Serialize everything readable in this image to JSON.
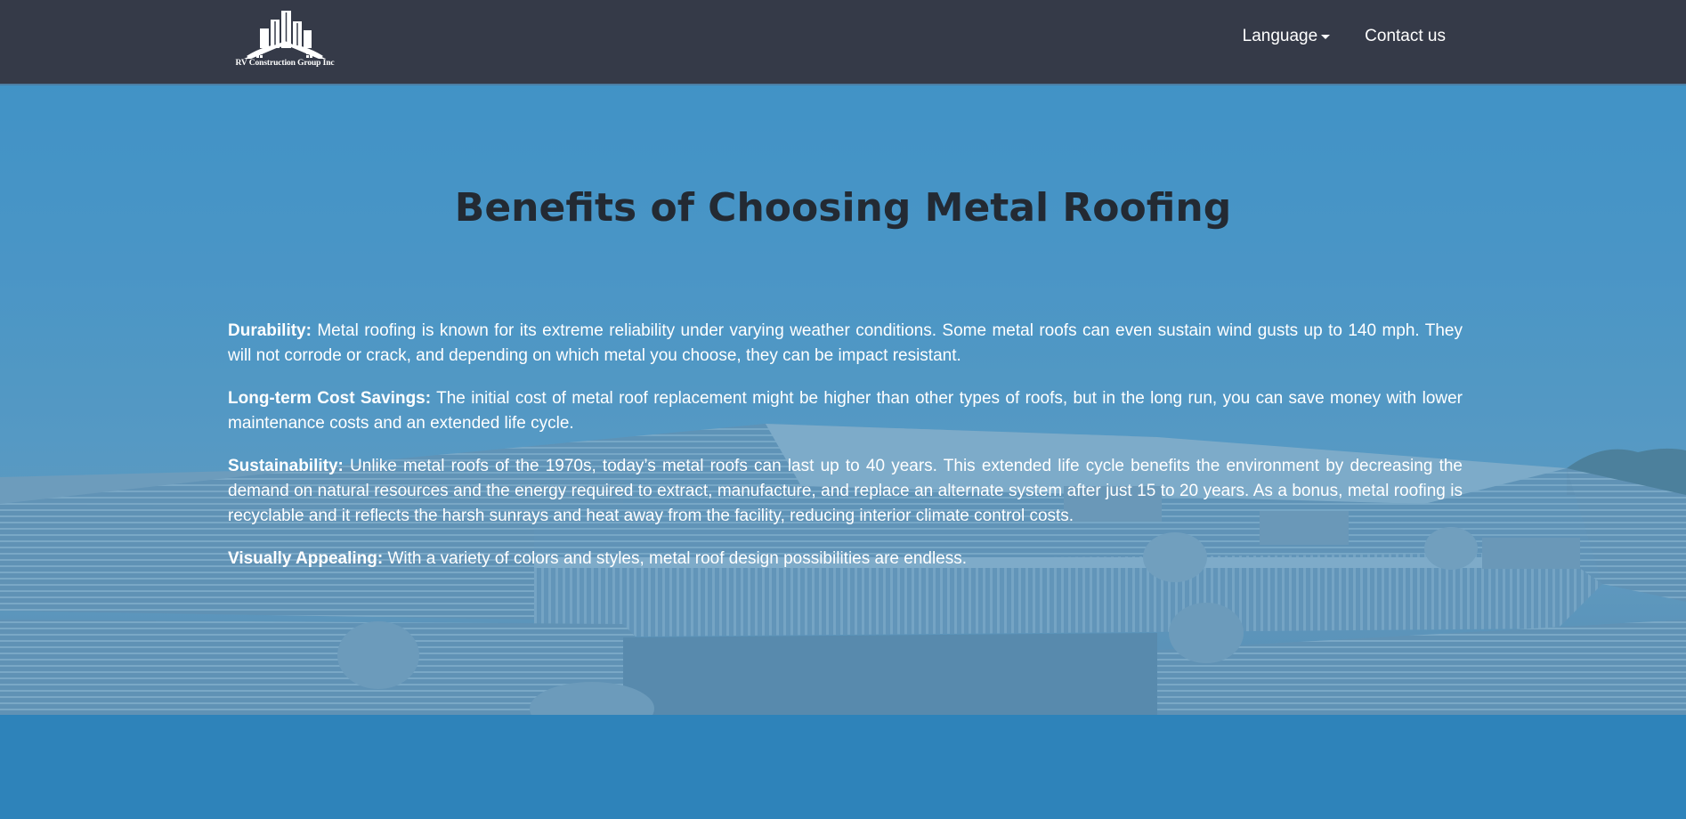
{
  "header": {
    "logo_text": "RV Construction Group Inc",
    "nav": {
      "language_label": "Language",
      "contact_label": "Contact us"
    }
  },
  "hero": {
    "title": "Benefits of Choosing Metal Roofing",
    "benefits": [
      {
        "label": "Durability:",
        "text": " Metal roofing is known for its extreme reliability under varying weather conditions. Some metal roofs can even sustain wind gusts up to 140 mph. They will not corrode or crack, and depending on which metal you choose, they can be impact resistant."
      },
      {
        "label": "Long-term Cost Savings:",
        "text": " The initial cost of metal roof replacement might be higher than other types of roofs, but in the long run, you can save money with lower maintenance costs and an extended life cycle."
      },
      {
        "label": "Sustainability:",
        "text": " Unlike metal roofs of the 1970s, today’s metal roofs can last up to 40 years. This extended life cycle benefits the environment by decreasing the demand on natural resources and the energy required to extract, manufacture, and replace an alternate system after just 15 to 20 years. As a bonus, metal roofing is recyclable and it reflects the harsh sunrays and heat away from the facility, reducing interior climate control costs."
      },
      {
        "label": "Visually Appealing:",
        "text": " With a variety of colors and styles, metal roof design possibilities are endless."
      }
    ]
  },
  "colors": {
    "navbar_bg": "#353a48",
    "page_bg": "#2e83ba",
    "title_color": "#232a33",
    "text_color": "#ffffff"
  },
  "icons": {
    "logo": "building-house-logo-icon",
    "language_dropdown": "caret-down-icon"
  }
}
